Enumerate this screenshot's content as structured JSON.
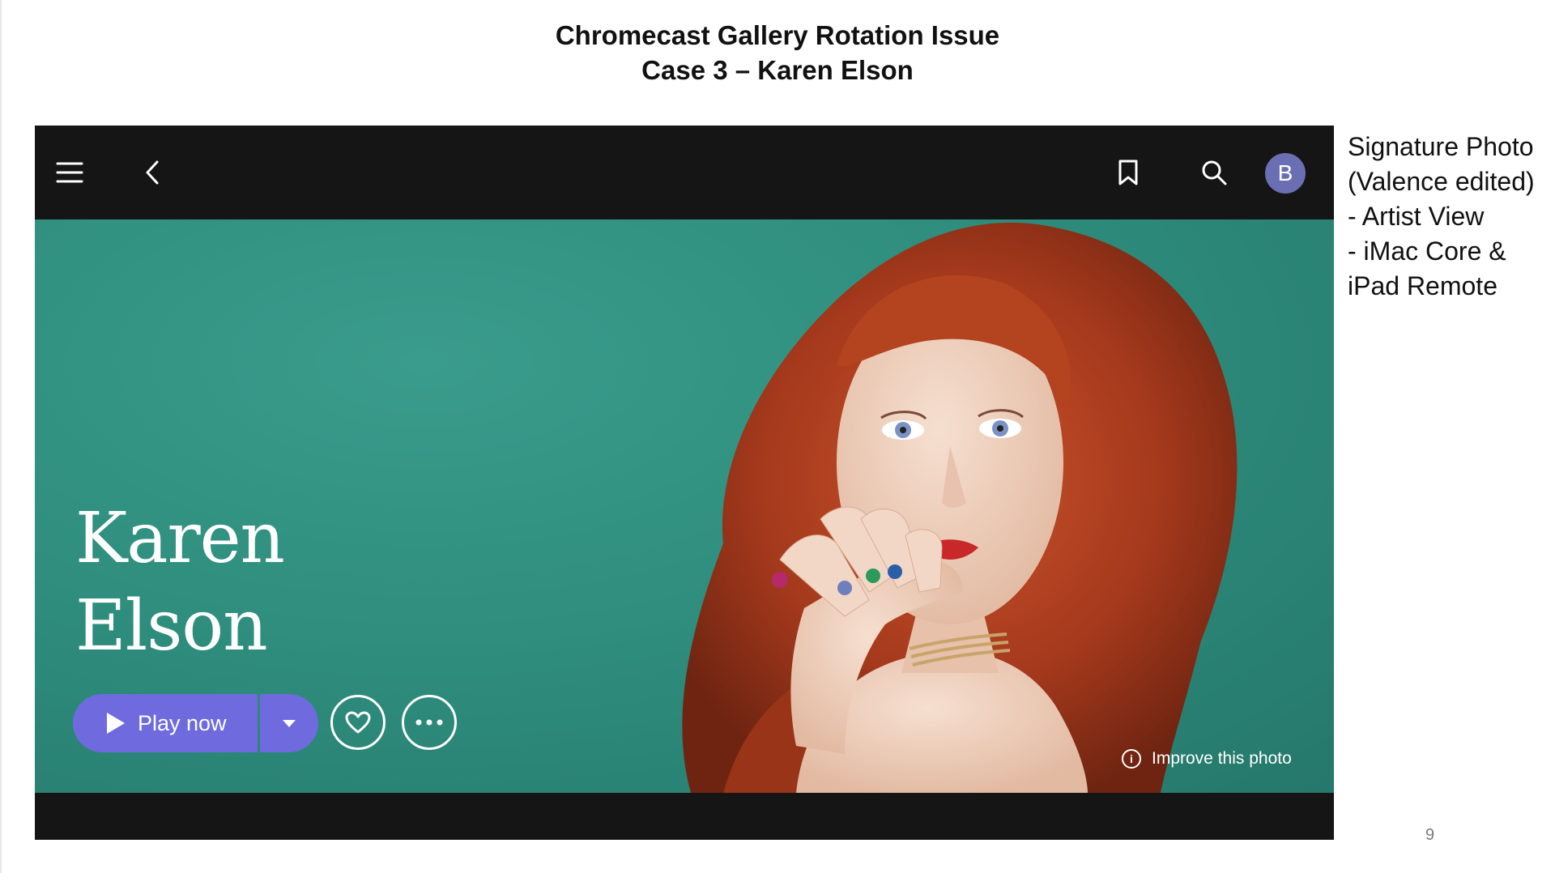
{
  "slide": {
    "title_line1": "Chromecast Gallery Rotation Issue",
    "title_line2": "Case 3 – Karen Elson",
    "page_number": "9"
  },
  "side_note": {
    "lines": [
      "Signature Photo",
      "(Valence edited)",
      "- Artist View",
      "- iMac Core &",
      "iPad Remote"
    ]
  },
  "app": {
    "top_bar": {
      "menu_icon": "hamburger-menu-icon",
      "back_icon": "chevron-left-icon",
      "bookmark_icon": "bookmark-icon",
      "search_icon": "search-icon",
      "avatar_initial": "B"
    },
    "artist": {
      "name_line1": "Karen",
      "name_line2": "Elson"
    },
    "actions": {
      "play_label": "Play now",
      "favorite_icon": "heart-icon",
      "more_icon": "more-horizontal-icon"
    },
    "photo_credit_label": "Improve this photo",
    "colors": {
      "accent": "#6f6bdf",
      "background": "#151515",
      "hero_teal": "#2f8e7e",
      "avatar": "#6a6fb3"
    }
  }
}
